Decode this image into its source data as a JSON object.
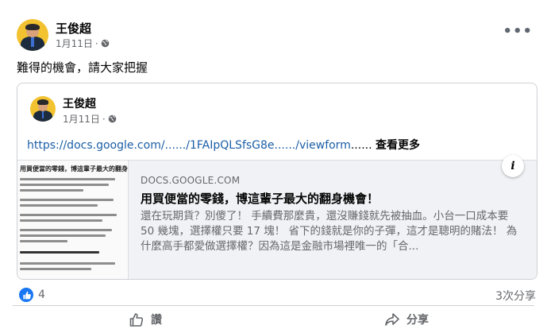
{
  "post": {
    "author": "王俊超",
    "date": "1月11日",
    "date_sep": "·",
    "privacy_icon": "globe-icon",
    "more_icon": "more-horizontal-icon",
    "more_label": "•••",
    "text": "難得的機會，請大家把握"
  },
  "shared": {
    "author": "王俊超",
    "date": "1月11日",
    "date_sep": "·",
    "link_text": "https://docs.google.com/....../1FAIpQLSfsG8e....../viewform",
    "ellipsis": "...... ",
    "see_more": "查看更多"
  },
  "preview": {
    "thumbnail_title": "用買便當的零錢，博這輩子最大的翻身機",
    "domain": "DOCS.GOOGLE.COM",
    "title": "用買便當的零錢，博這輩子最大的翻身機會！",
    "description": "還在玩期貨？別傻了！ 手續費那麼貴，還沒賺錢就先被抽血。小台一口成本要 50 幾塊，選擇權只要 17 塊！ 省下的錢就是你的子彈，這才是聰明的賭法！ 為什麼高手都愛做選擇權？因為這是金融市場裡唯一的「合...",
    "info_label": "i"
  },
  "footer": {
    "reaction_count": "4",
    "shares": "3次分享",
    "like_label": "讚",
    "share_label": "分享"
  },
  "colors": {
    "link": "#1b5ea6",
    "like_blue": "#1877f2",
    "secondary_text": "#65676b"
  }
}
